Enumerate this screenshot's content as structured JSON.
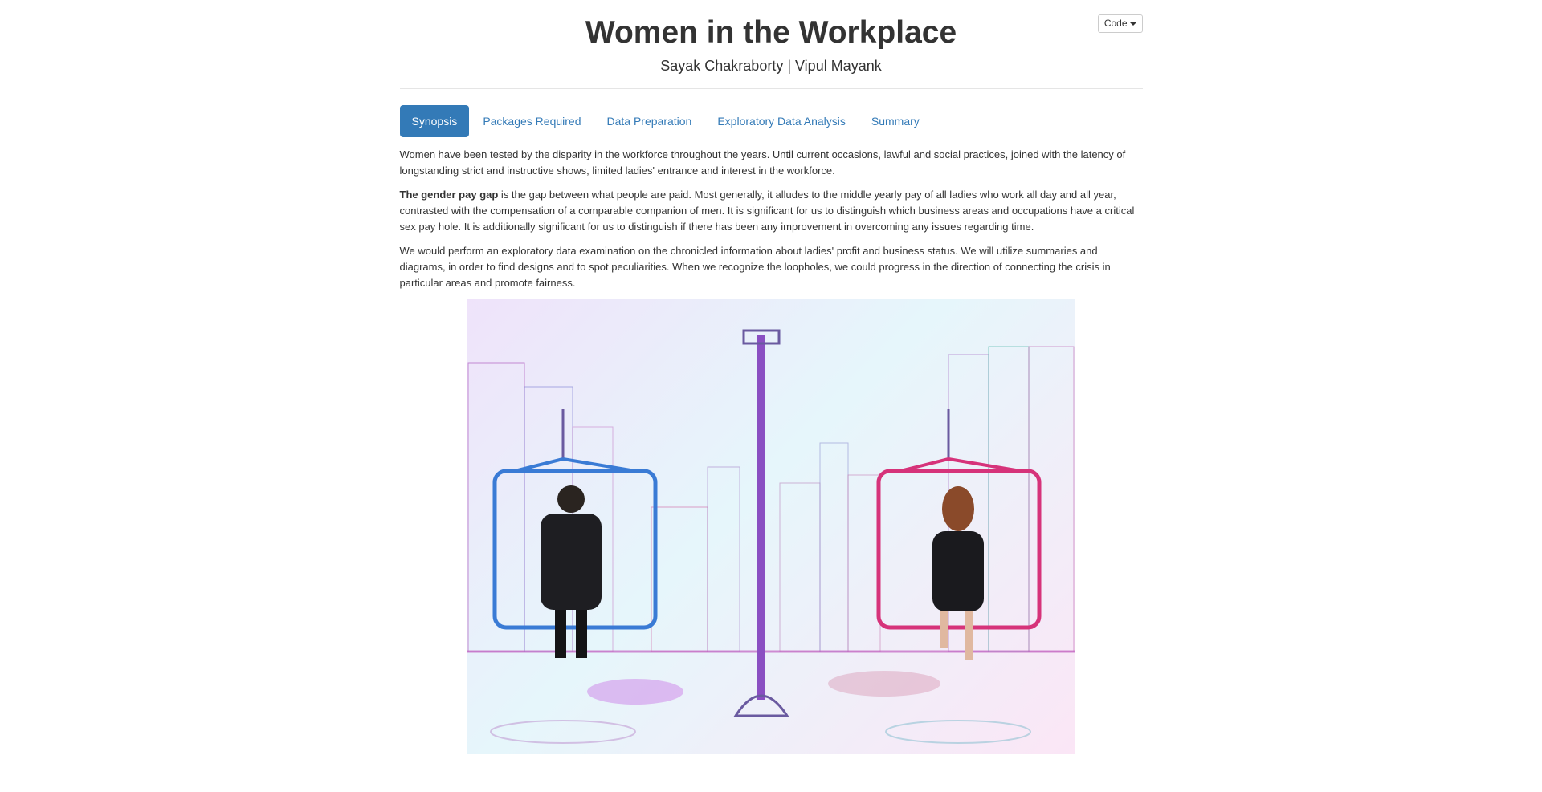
{
  "header": {
    "title": "Women in the Workplace",
    "author": "Sayak Chakraborty | Vipul Mayank",
    "code_button": "Code"
  },
  "tabs": [
    {
      "label": "Synopsis",
      "active": true
    },
    {
      "label": "Packages Required",
      "active": false
    },
    {
      "label": "Data Preparation",
      "active": false
    },
    {
      "label": "Exploratory Data Analysis",
      "active": false
    },
    {
      "label": "Summary",
      "active": false
    }
  ],
  "content": {
    "paragraph1": "Women have been tested by the disparity in the workforce throughout the years. Until current occasions, lawful and social practices, joined with the latency of longstanding strict and instructive shows, limited ladies' entrance and interest in the workforce.",
    "paragraph2_bold": "The gender pay gap",
    "paragraph2_rest": " is the gap between what people are paid. Most generally, it alludes to the middle yearly pay of all ladies who work all day and all year, contrasted with the compensation of a comparable companion of men. It is significant for us to distinguish which business areas and occupations have a critical sex pay hole. It is additionally significant for us to distinguish if there has been any improvement in overcoming any issues regarding time.",
    "paragraph3": "We would perform an exploratory data examination on the chronicled information about ladies' profit and business status. We will utilize summaries and diagrams, in order to find designs and to spot peculiarities. When we recognize the loopholes, we could progress in the direction of connecting the crisis in particular areas and promote fairness."
  },
  "colors": {
    "accent": "#337ab7",
    "male_scale": "#3a7bd5",
    "female_scale": "#d6337a"
  }
}
